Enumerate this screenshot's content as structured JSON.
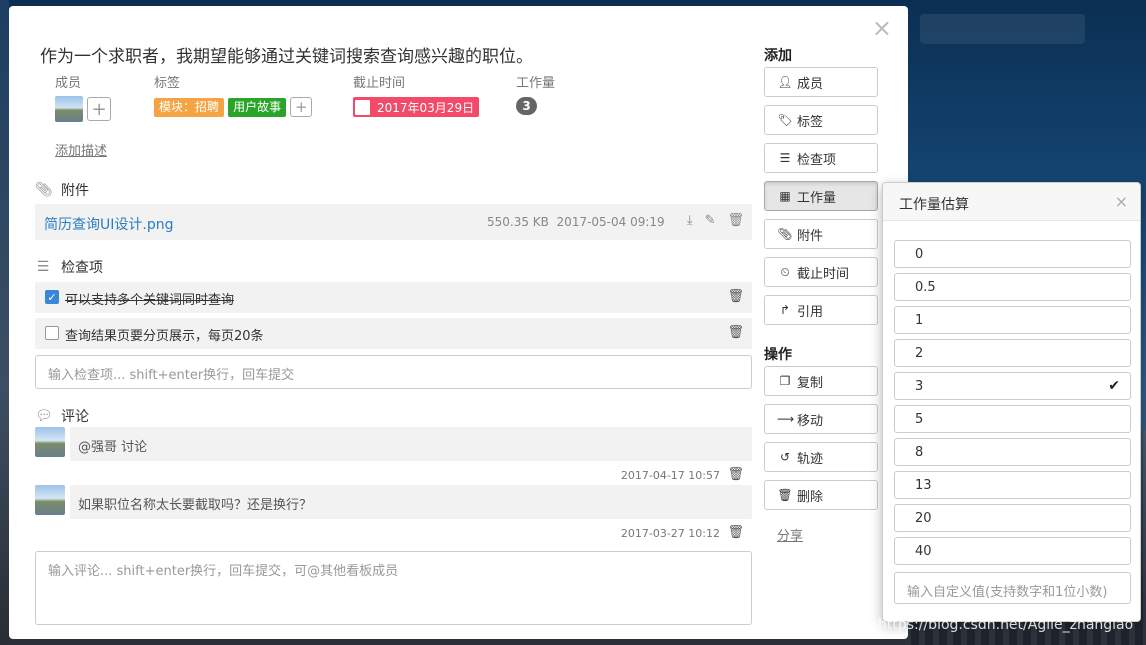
{
  "card": {
    "title": "作为一个求职者，我期望能够通过关键词搜索查询感兴趣的职位。",
    "members_label": "成员",
    "tags_label": "标签",
    "deadline_label": "截止时间",
    "workload_label": "工作量",
    "tags": [
      "模块：招聘",
      "用户故事"
    ],
    "deadline": "2017年03月29日",
    "workload": "3",
    "add_description": "添加描述",
    "plus": "+",
    "close": "×"
  },
  "attachments": {
    "heading": "附件",
    "items": [
      {
        "name": "简历查询UI设计.png",
        "size": "550.35 KB",
        "time": "2017-05-04 09:19"
      }
    ]
  },
  "checklist": {
    "heading": "检查项",
    "items": [
      {
        "text": "可以支持多个关键词同时查询",
        "done": true
      },
      {
        "text": "查询结果页要分页展示，每页20条",
        "done": false
      }
    ],
    "input_placeholder": "输入检查项... shift+enter换行，回车提交"
  },
  "comments": {
    "heading": "评论",
    "items": [
      {
        "text": "@强哥 讨论",
        "time": "2017-04-17 10:57"
      },
      {
        "text": "如果职位名称太长要截取吗？还是换行？",
        "time": "2017-03-27 10:12"
      }
    ],
    "input_placeholder": "输入评论... shift+enter换行，回车提交，可@其他看板成员"
  },
  "sidebar": {
    "add_heading": "添加",
    "add_buttons": [
      "成员",
      "标签",
      "检查项",
      "工作量",
      "附件",
      "截止时间",
      "引用"
    ],
    "ops_heading": "操作",
    "op_buttons": [
      "复制",
      "移动",
      "轨迹",
      "删除"
    ],
    "share": "分享"
  },
  "estimate_popover": {
    "title": "工作量估算",
    "options": [
      "0",
      "0.5",
      "1",
      "2",
      "3",
      "5",
      "8",
      "13",
      "20",
      "40"
    ],
    "selected": "3",
    "custom_placeholder": "输入自定义值(支持数字和1位小数)"
  },
  "watermark": "https://blog.csdn.net/Agile_zhanglao"
}
